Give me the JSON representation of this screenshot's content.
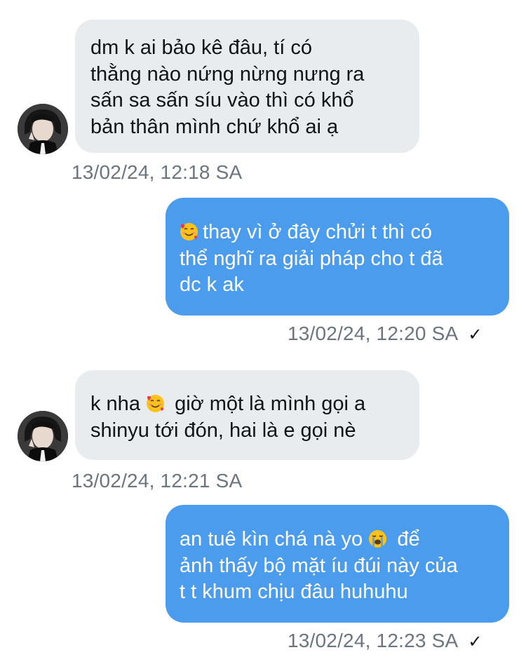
{
  "messages": [
    {
      "direction": "incoming",
      "lines": [
        "dm k ai bảo kê đâu, tí có",
        "thằng nào nứng nừng nưng ra",
        "sấn sa sấn síu vào thì có khổ",
        "bản thân mình chứ khổ ai ạ"
      ],
      "timestamp": "13/02/24, 12:18 SA"
    },
    {
      "direction": "outgoing",
      "lines": [
        "thay vì ở đây chửi t thì có",
        "thể nghĩ ra giải pháp cho t đã",
        "dc k ak"
      ],
      "leading_emoji": "smiling-face-with-hearts",
      "timestamp": "13/02/24, 12:20 SA",
      "read_mark": "✓"
    },
    {
      "direction": "incoming",
      "lines_parts": [
        {
          "before": "k nha",
          "emoji": "smiling-face-with-hearts",
          "after": "giờ một là mình gọi a"
        },
        {
          "text": "shinyu tới đón, hai là e gọi nè"
        }
      ],
      "timestamp": "13/02/24, 12:21 SA"
    },
    {
      "direction": "outgoing",
      "lines_parts": [
        {
          "before": "an tuê kìn chá nà yo",
          "emoji": "loudly-crying-face",
          "after": "để"
        },
        {
          "text": "ảnh thấy bộ mặt íu đúi này của"
        },
        {
          "text": "t t khum chịu đâu huhuhu"
        }
      ],
      "timestamp": "13/02/24, 12:23 SA",
      "read_mark": "✓"
    }
  ],
  "colors": {
    "incoming_bubble": "#e9ecef",
    "outgoing_bubble": "#4b9cec",
    "timestamp": "#6b7580"
  },
  "icons": [
    "user-avatar",
    "smiling-face-with-hearts",
    "loudly-crying-face",
    "check-icon"
  ]
}
